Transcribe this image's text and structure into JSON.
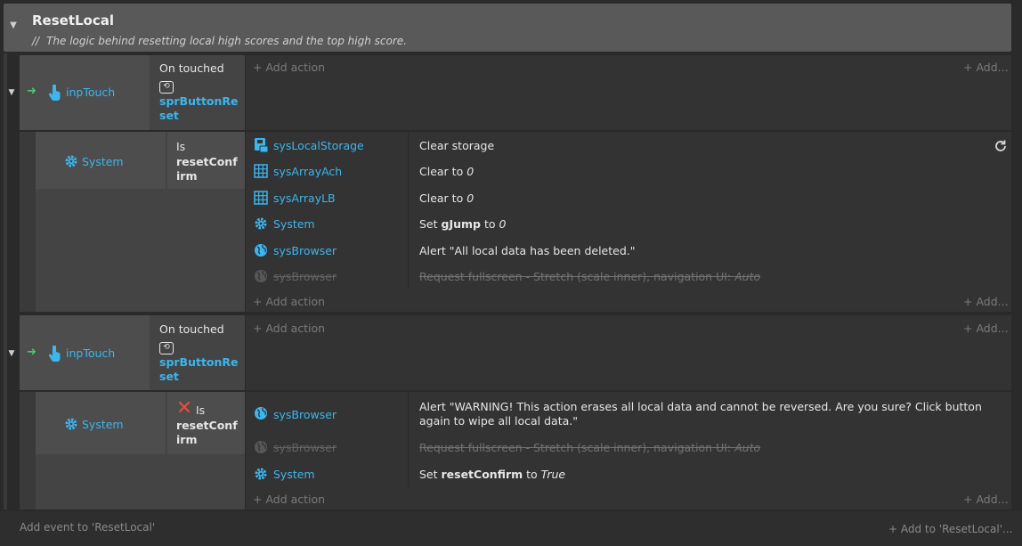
{
  "group": {
    "title": "ResetLocal",
    "comment_prefix": "//",
    "comment": "The logic behind resetting local high scores and the top high score."
  },
  "events": [
    {
      "object": "inpTouch",
      "trigger": "On touched",
      "target": "sprButtonReset",
      "add_action": "Add action",
      "add_more": "Add...",
      "sub": {
        "object": "System",
        "cond_prefix": "Is",
        "cond_var": "resetConfirm",
        "inverted": false,
        "actions": [
          {
            "object": "sysLocalStorage",
            "icon": "storage-icon",
            "text": "Clear storage",
            "disabled": false
          },
          {
            "object": "sysArrayAch",
            "icon": "array-icon",
            "text": "Clear to ",
            "value": "0",
            "disabled": false
          },
          {
            "object": "sysArrayLB",
            "icon": "array-icon",
            "text": "Clear to ",
            "value": "0",
            "disabled": false
          },
          {
            "object": "System",
            "icon": "gear-icon",
            "text": "Set ",
            "var": "gJump",
            "mid": " to ",
            "value": "0",
            "disabled": false
          },
          {
            "object": "sysBrowser",
            "icon": "globe-icon",
            "text": "Alert \"All local data has been deleted.\"",
            "disabled": false
          },
          {
            "object": "sysBrowser",
            "icon": "globe-icon",
            "text": "Request fullscreen - Stretch (scale inner), navigation UI: ",
            "value": "Auto",
            "disabled": true
          }
        ],
        "add_action": "Add action",
        "add_more": "Add..."
      }
    },
    {
      "object": "inpTouch",
      "trigger": "On touched",
      "target": "sprButtonReset",
      "add_action": "Add action",
      "add_more": "Add...",
      "sub": {
        "object": "System",
        "cond_prefix": "Is",
        "cond_var": "resetConfirm",
        "inverted": true,
        "actions": [
          {
            "object": "sysBrowser",
            "icon": "globe-icon",
            "text": "Alert \"WARNING! This action erases all local data and cannot be reversed. Are you sure? Click button again to wipe all local data.\"",
            "disabled": false
          },
          {
            "object": "sysBrowser",
            "icon": "globe-icon",
            "text": "Request fullscreen - Stretch (scale inner), navigation UI: ",
            "value": "Auto",
            "disabled": true
          },
          {
            "object": "System",
            "icon": "gear-icon",
            "text": "Set ",
            "var": "resetConfirm",
            "mid": " to ",
            "value": "True",
            "disabled": false
          }
        ],
        "add_action": "Add action",
        "add_more": "Add..."
      }
    }
  ],
  "footer": {
    "add_event": "Add event to 'ResetLocal'",
    "add_to": "Add to 'ResetLocal'..."
  },
  "colors": {
    "object_link": "#3cb6ee",
    "trigger_arrow": "#48c774",
    "invert_x": "#e74c3c"
  }
}
